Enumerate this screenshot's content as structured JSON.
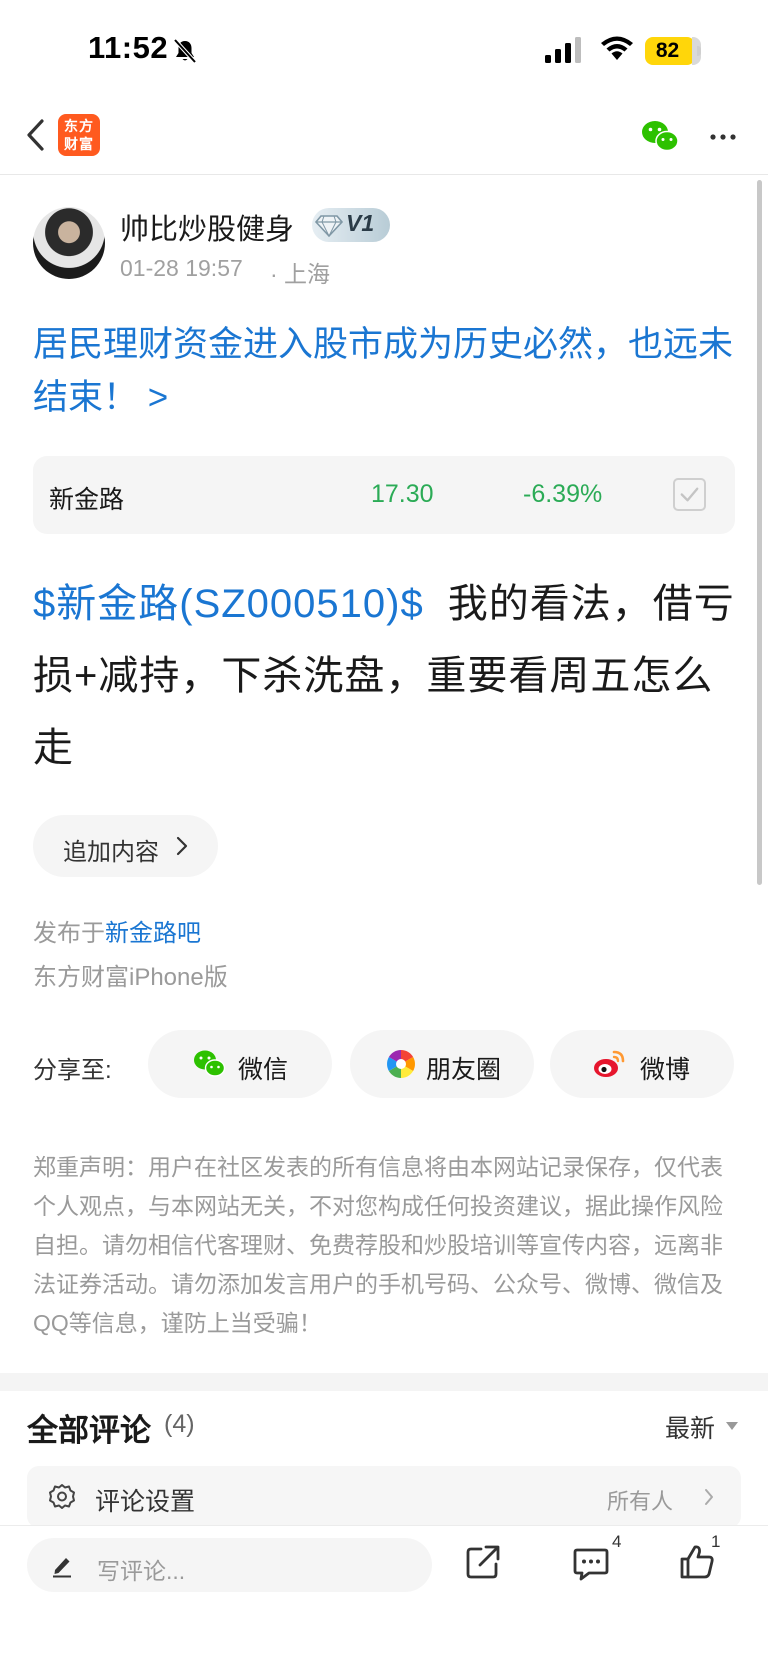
{
  "status_bar": {
    "time": "11:52",
    "battery": "82"
  },
  "nav": {
    "logo_line1": "东方",
    "logo_line2": "财富"
  },
  "post": {
    "author": "帅比炒股健身",
    "vip_level": "V1",
    "time": "01-28 19:57",
    "location": "· 上海",
    "title": "居民理财资金进入股市成为历史必然，也远未结束！ >",
    "stock_card": {
      "name": "新金路",
      "price": "17.30",
      "change": "-6.39%",
      "change_color": "#2bab56"
    },
    "body_stock": "$新金路(SZ000510)$",
    "body_text": "我的看法，借亏损+减持，下杀洗盘，重要看周五怎么走",
    "append_label": "追加内容",
    "published_prefix": "发布于",
    "forum_name": "新金路吧",
    "platform": "东方财富iPhone版"
  },
  "share": {
    "label": "分享至:",
    "wechat": "微信",
    "moments": "朋友圈",
    "weibo": "微博"
  },
  "disclaimer": "郑重声明：用户在社区发表的所有信息将由本网站记录保存，仅代表个人观点，与本网站无关，不对您构成任何投资建议，据此操作风险自担。请勿相信代客理财、免费荐股和炒股培训等宣传内容，远离非法证券活动。请勿添加发言用户的手机号码、公众号、微博、微信及QQ等信息，谨防上当受骗！",
  "comments": {
    "title": "全部评论",
    "count": "(4)",
    "sort": "最新",
    "settings_label": "评论设置",
    "settings_value": "所有人"
  },
  "bottom_bar": {
    "write_placeholder": "写评论...",
    "comment_count": "4",
    "like_count": "1"
  },
  "colors": {
    "link_blue": "#1a76d2",
    "stock_green": "#2bab56",
    "brand_orange": "#ff5a1f",
    "battery_yellow": "#ffd60a"
  }
}
